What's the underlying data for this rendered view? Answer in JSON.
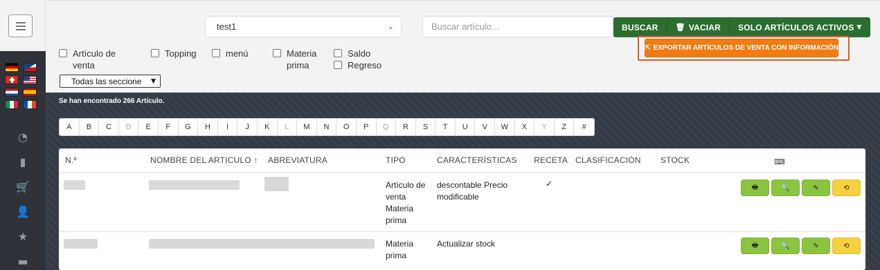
{
  "sidebar": {
    "icons": [
      {
        "name": "dashboard-icon",
        "glyph": "◔"
      },
      {
        "name": "bar-chart-icon",
        "glyph": "▮"
      },
      {
        "name": "cart-icon",
        "glyph": "🛒"
      },
      {
        "name": "user-plus-icon",
        "glyph": "👤"
      },
      {
        "name": "star-icon",
        "glyph": "★"
      },
      {
        "name": "archive-icon",
        "glyph": "▬"
      }
    ],
    "flags": [
      "de",
      "cz",
      "ch",
      "us",
      "nl",
      "es",
      "it",
      "fr"
    ]
  },
  "filters": {
    "store_value": "test1",
    "search_placeholder": "Buscar artículo...",
    "buscar_label": "BUSCAR",
    "vaciar_label": "VACIAR",
    "solo_label": "SOLO ARTÍCULOS ACTIVOS",
    "export_label": "EXPORTAR ARTÍCULOS DE VENTA CON INFORMACIÓN",
    "checkboxes": {
      "articulo_venta": "Artículo de venta",
      "topping": "Topping",
      "menu": "menú",
      "materia_prima": "Materia prima",
      "saldo": "Saldo",
      "regreso": "Regreso"
    },
    "section_value": "Todas las seccione"
  },
  "results": {
    "found_text": "Se han encontrado 266 Artículo."
  },
  "alphabet": [
    "A",
    "B",
    "C",
    "D",
    "E",
    "F",
    "G",
    "H",
    "I",
    "J",
    "K",
    "L",
    "M",
    "N",
    "O",
    "P",
    "Q",
    "R",
    "S",
    "T",
    "U",
    "V",
    "W",
    "X",
    "Y",
    "Z",
    "#"
  ],
  "alphabet_disabled": [
    "D",
    "L",
    "Q",
    "Y"
  ],
  "table": {
    "headers": {
      "num": "N.º",
      "name": "NOMBRE DEL ARTICULO ↑",
      "abbr": "ABREVIATURA",
      "tipo": "TIPO",
      "caract": "CARACTERÍSTICAS",
      "receta": "RECETA",
      "clasif": "CLASIFICACIÓN",
      "stock": "STOCK",
      "keyboard_icon": "⌨"
    },
    "rows": [
      {
        "tipo": "Artículo de venta Materia prima",
        "caract": "descontable Precio modificable",
        "receta": "✓"
      },
      {
        "tipo": "Materia prima",
        "caract": "Actualizar stock",
        "receta": ""
      }
    ],
    "actions": {
      "print_icon": "🖶",
      "search_icon": "🔍",
      "edit_icon": "✎",
      "history_icon": "⟲"
    }
  },
  "colors": {
    "accent_green": "#2c6e2f",
    "export_orange": "#f07c12",
    "highlight_red": "#e05a2b",
    "action_green": "#8bc53f",
    "action_yellow": "#f7d040"
  }
}
